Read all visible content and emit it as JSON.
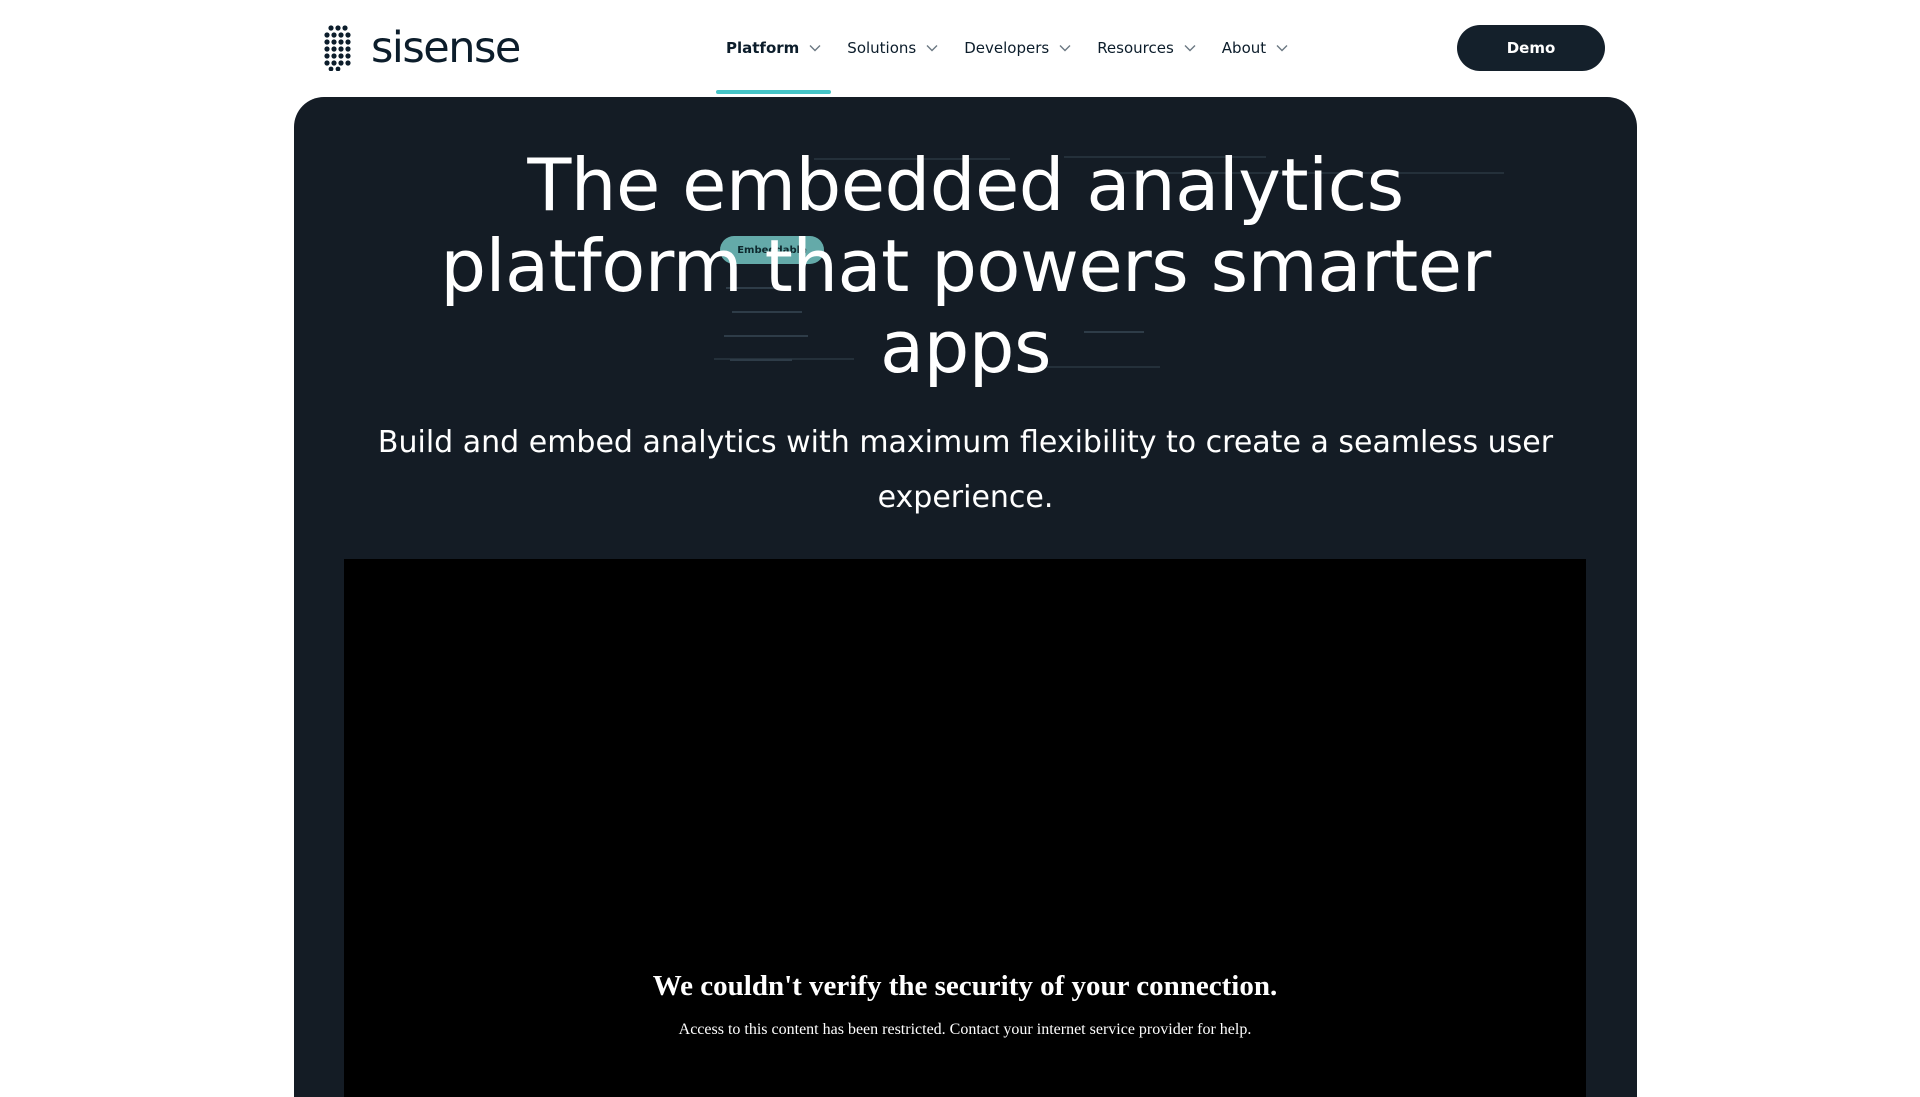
{
  "brand": {
    "name": "sisense",
    "accent_color": "#45c4c7",
    "dark_color": "#14202b"
  },
  "nav": {
    "items": [
      {
        "label": "Platform",
        "active": true
      },
      {
        "label": "Solutions",
        "active": false
      },
      {
        "label": "Developers",
        "active": false
      },
      {
        "label": "Resources",
        "active": false
      },
      {
        "label": "About",
        "active": false
      }
    ],
    "demo_label": "Demo"
  },
  "hero": {
    "title_lines": [
      "The embedded analytics",
      "platform that powers smarter",
      "apps"
    ],
    "subtitle": "Build and embed analytics with maximum flexibility to create a seamless user experience.",
    "embeddable_label": "Embeddable",
    "background_color": "#141c25"
  },
  "embed": {
    "error_title": "We couldn't verify the security of your connection.",
    "error_body": "Access to this content has been restricted. Contact your internet service provider for help."
  }
}
